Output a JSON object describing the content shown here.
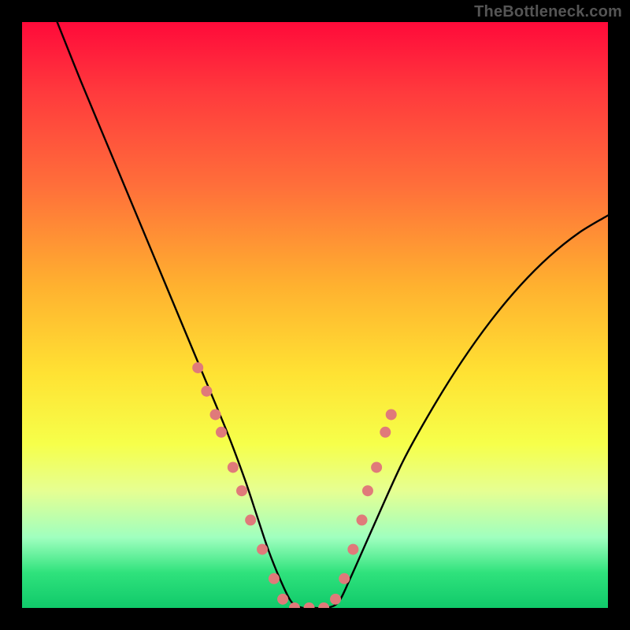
{
  "watermark": "TheBottleneck.com",
  "chart_data": {
    "type": "line",
    "title": "",
    "xlabel": "",
    "ylabel": "",
    "xlim": [
      0,
      100
    ],
    "ylim": [
      0,
      100
    ],
    "grid": false,
    "legend": false,
    "series": [
      {
        "name": "curve",
        "x": [
          6,
          10,
          15,
          20,
          25,
          30,
          35,
          38,
          40,
          42,
          44,
          46,
          48,
          50,
          52,
          54,
          56,
          60,
          65,
          70,
          75,
          80,
          85,
          90,
          95,
          100
        ],
        "y": [
          100,
          90,
          78,
          66,
          54,
          42,
          30,
          22,
          16,
          10,
          5,
          1,
          0,
          0,
          0,
          1,
          5,
          14,
          25,
          34,
          42,
          49,
          55,
          60,
          64,
          67
        ]
      }
    ],
    "markers": {
      "name": "dots",
      "color": "#e07a7a",
      "radius_px": 7,
      "x": [
        30.0,
        31.5,
        33.0,
        34.0,
        36.0,
        37.5,
        39.0,
        41.0,
        43.0,
        44.5,
        46.5,
        49.0,
        51.5,
        53.5,
        55.0,
        56.5,
        58.0,
        59.0,
        60.5,
        62.0,
        63.0
      ],
      "y": [
        41.0,
        37.0,
        33.0,
        30.0,
        24.0,
        20.0,
        15.0,
        10.0,
        5.0,
        1.5,
        0.0,
        0.0,
        0.0,
        1.5,
        5.0,
        10.0,
        15.0,
        20.0,
        24.0,
        30.0,
        33.0
      ]
    },
    "gradient_stops": [
      {
        "pos": 0.0,
        "color": "#ff0a3a"
      },
      {
        "pos": 0.12,
        "color": "#ff3a3d"
      },
      {
        "pos": 0.28,
        "color": "#ff6f3a"
      },
      {
        "pos": 0.45,
        "color": "#ffb12f"
      },
      {
        "pos": 0.6,
        "color": "#ffe233"
      },
      {
        "pos": 0.72,
        "color": "#f6ff4a"
      },
      {
        "pos": 0.8,
        "color": "#e6ff92"
      },
      {
        "pos": 0.88,
        "color": "#9fffbf"
      },
      {
        "pos": 0.94,
        "color": "#2fe27c"
      },
      {
        "pos": 1.0,
        "color": "#10c96a"
      }
    ]
  }
}
